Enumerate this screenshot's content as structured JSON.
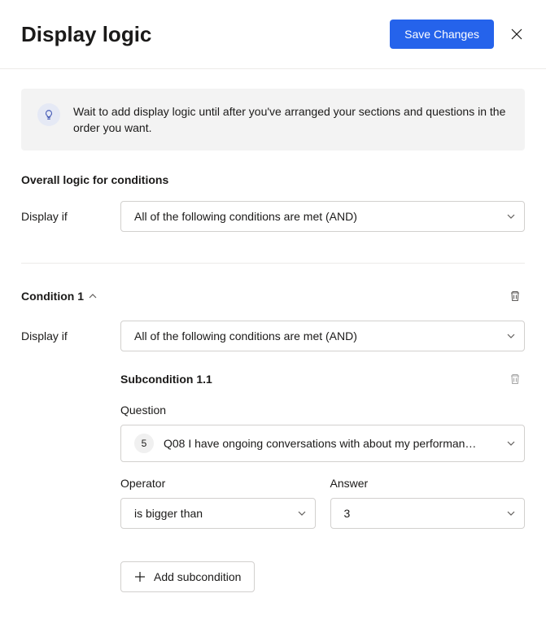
{
  "header": {
    "title": "Display logic",
    "save_button": "Save Changes"
  },
  "info_banner": {
    "text": "Wait to add display logic until after you've arranged your sections and questions in the order you want."
  },
  "overall_logic": {
    "heading": "Overall logic for conditions",
    "display_if_label": "Display if",
    "display_if_value": "All of the following conditions are met (AND)"
  },
  "condition": {
    "title": "Condition 1",
    "display_if_label": "Display if",
    "display_if_value": "All of the following conditions are met (AND)",
    "subcondition": {
      "title": "Subcondition 1.1",
      "question_label": "Question",
      "question_badge": "5",
      "question_value": "Q08 I have ongoing conversations with about my performan…",
      "operator_label": "Operator",
      "operator_value": "is bigger than",
      "answer_label": "Answer",
      "answer_value": "3"
    },
    "add_subcondition_label": "Add subcondition"
  }
}
